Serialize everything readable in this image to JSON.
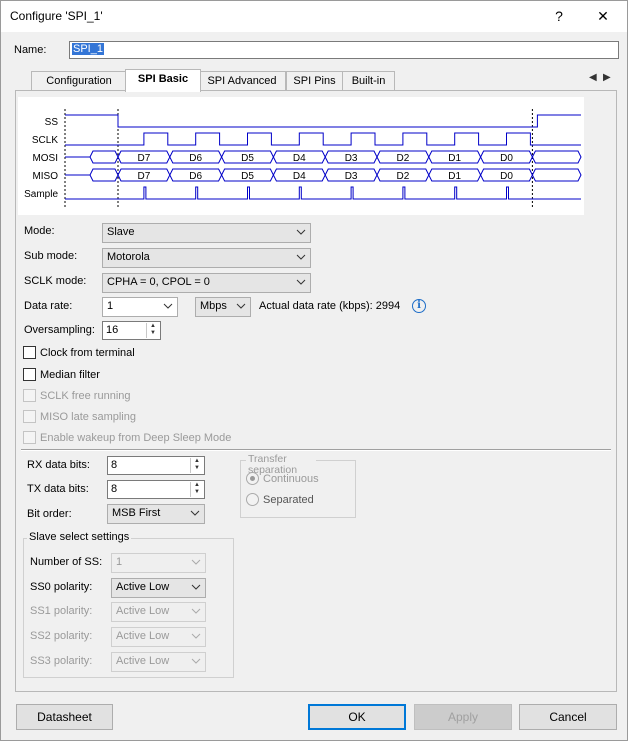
{
  "window": {
    "title": "Configure 'SPI_1'",
    "help_glyph": "?",
    "close_glyph": "✕"
  },
  "name": {
    "label": "Name:",
    "value": "SPI_1"
  },
  "tabs": [
    {
      "label": "Configuration"
    },
    {
      "label": "SPI Basic"
    },
    {
      "label": "SPI Advanced"
    },
    {
      "label": "SPI Pins"
    },
    {
      "label": "Built-in"
    }
  ],
  "tab_scroll": {
    "left": "◀",
    "right": "▶"
  },
  "diagram": {
    "signals": [
      "SS",
      "SCLK",
      "MOSI",
      "MISO",
      "Sample"
    ],
    "bits": [
      "D7",
      "D6",
      "D5",
      "D4",
      "D3",
      "D2",
      "D1",
      "D0"
    ]
  },
  "mode": {
    "label": "Mode:",
    "value": "Slave"
  },
  "sub_mode": {
    "label": "Sub mode:",
    "value": "Motorola"
  },
  "sclk_mode": {
    "label": "SCLK mode:",
    "value": "CPHA = 0, CPOL = 0"
  },
  "data_rate": {
    "label": "Data rate:",
    "value": "1",
    "unit": "Mbps",
    "actual_label": "Actual data rate (kbps): 2994"
  },
  "oversampling": {
    "label": "Oversampling:",
    "value": "16"
  },
  "checks": {
    "clock_from_terminal": "Clock from terminal",
    "median_filter": "Median filter",
    "sclk_free_running": "SCLK free running",
    "miso_late_sampling": "MISO late sampling",
    "enable_wakeup": "Enable wakeup from Deep Sleep Mode"
  },
  "rx_bits": {
    "label": "RX data bits:",
    "value": "8"
  },
  "tx_bits": {
    "label": "TX data bits:",
    "value": "8"
  },
  "bit_order": {
    "label": "Bit order:",
    "value": "MSB First"
  },
  "transfer": {
    "title": "Transfer separation",
    "continuous": "Continuous",
    "separated": "Separated"
  },
  "slave_select": {
    "title": "Slave select settings",
    "number_label": "Number of SS:",
    "number_value": "1",
    "ss0_label": "SS0 polarity:",
    "ss0_value": "Active Low",
    "ss1_label": "SS1 polarity:",
    "ss1_value": "Active Low",
    "ss2_label": "SS2 polarity:",
    "ss2_value": "Active Low",
    "ss3_label": "SS3 polarity:",
    "ss3_value": "Active Low"
  },
  "buttons": {
    "datasheet": "Datasheet",
    "ok": "OK",
    "apply": "Apply",
    "cancel": "Cancel"
  },
  "colors": {
    "wave_blue": "#0000c8",
    "accent": "#0078d7",
    "selection": "#3375d6"
  }
}
